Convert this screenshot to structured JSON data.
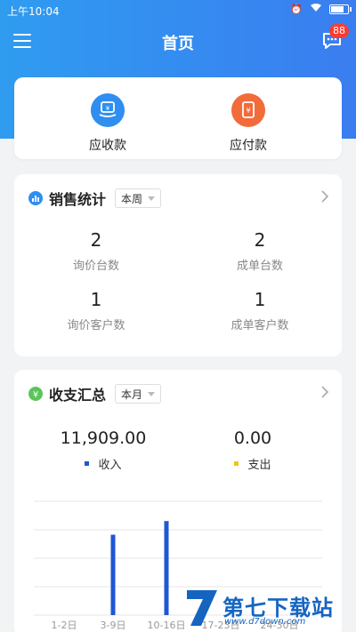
{
  "status": {
    "time": "上午10:04"
  },
  "header": {
    "title": "首页",
    "badge": "88"
  },
  "quick_actions": [
    {
      "label": "应收款",
      "color": "#2f8ef0",
      "icon": "receivable-icon"
    },
    {
      "label": "应付款",
      "color": "#f26b3a",
      "icon": "payable-icon"
    }
  ],
  "sales": {
    "title": "销售统计",
    "period": "本周",
    "stats": [
      {
        "value": "2",
        "label": "询价台数"
      },
      {
        "value": "2",
        "label": "成单台数"
      },
      {
        "value": "1",
        "label": "询价客户数"
      },
      {
        "value": "1",
        "label": "成单客户数"
      }
    ]
  },
  "finance": {
    "title": "收支汇总",
    "period": "本月",
    "income": {
      "amount": "11,909.00",
      "label": "收入",
      "color": "#1e56d6"
    },
    "expense": {
      "amount": "0.00",
      "label": "支出",
      "color": "#f0c419"
    }
  },
  "chart_data": {
    "type": "bar",
    "categories": [
      "1-2日",
      "3-9日",
      "10-16日",
      "17-23日",
      "24-30日"
    ],
    "series": [
      {
        "name": "收入",
        "values": [
          0,
          5300,
          6200,
          0,
          0
        ]
      },
      {
        "name": "支出",
        "values": [
          0,
          0,
          0,
          0,
          0
        ]
      }
    ],
    "ylim": [
      0,
      7500
    ],
    "grid": true,
    "colors": {
      "income": "#1e56d6",
      "expense": "#f0c419"
    }
  },
  "watermark": {
    "text": "第七下载站",
    "url": "www.d7down.com"
  },
  "colors": {
    "brand": "#2f9cf0",
    "sales_icon": "#2f8ef0",
    "finance_icon": "#5cc45a"
  }
}
